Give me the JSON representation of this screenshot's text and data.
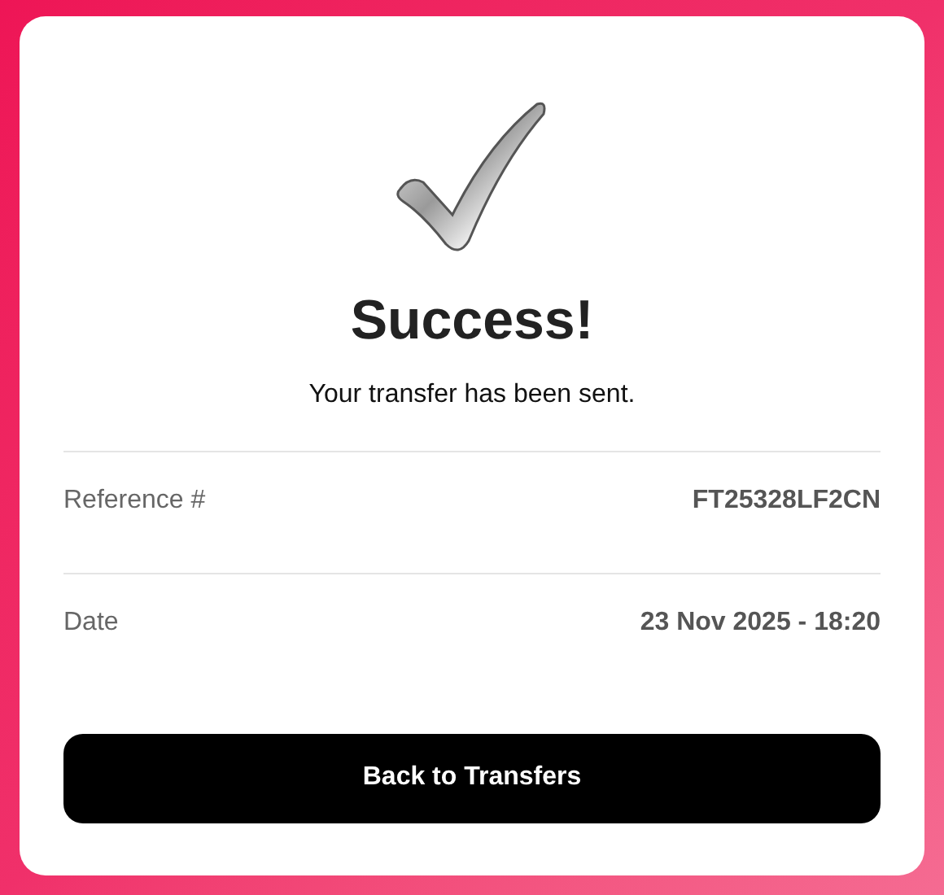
{
  "title": "Success!",
  "message": "Your transfer has been sent.",
  "details": [
    {
      "label": "Reference #",
      "value": "FT25328LF2CN"
    },
    {
      "label": "Date",
      "value": "23 Nov 2025 - 18:20"
    }
  ],
  "button": "Back to Transfers"
}
